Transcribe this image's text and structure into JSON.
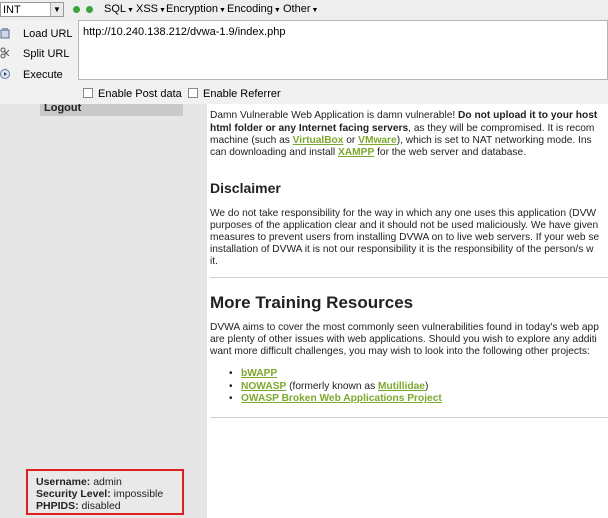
{
  "hackbar": {
    "select_value": "INT",
    "menus": [
      "SQL",
      "XSS",
      "Encryption",
      "Encoding",
      "Other"
    ],
    "load_url": "Load URL",
    "split_url": "Split URL",
    "execute": "Execute",
    "url": "http://10.240.138.212/dvwa-1.9/index.php",
    "enable_post": "Enable Post data",
    "enable_referrer": "Enable Referrer"
  },
  "sidebar": {
    "logout": "Logout"
  },
  "content": {
    "intro_l1_a": "Damn Vulnerable Web Application is damn vulnerable! ",
    "intro_l1_b": "Do not upload it to your host",
    "intro_l2_a": "html folder or any Internet facing servers",
    "intro_l2_b": ", as they will be compromised. It is recom",
    "intro_l3_a": "machine (such as ",
    "intro_l3_link1": "VirtualBox",
    "intro_l3_b": " or ",
    "intro_l3_link2": "VMware",
    "intro_l3_c": "), which is set to NAT networking mode. Ins",
    "intro_l4_a": "can downloading and install ",
    "intro_l4_link": "XAMPP",
    "intro_l4_b": " for the web server and database.",
    "disclaimer_title": "Disclaimer",
    "disc_l1": "We do not take responsibility for the way in which any one uses this application (DVW",
    "disc_l2": "purposes of the application clear and it should not be used maliciously. We have given",
    "disc_l3": "measures to prevent users from installing DVWA on to live web servers. If your web se",
    "disc_l4": "installation of DVWA it is not our responsibility it is the responsibility of the person/s w",
    "disc_l5": "it.",
    "training_title": "More Training Resources",
    "train_l1": "DVWA aims to cover the most commonly seen vulnerabilities found in today's web app",
    "train_l2": "are plenty of other issues with web applications. Should you wish to explore any additi",
    "train_l3": "want more difficult challenges, you may wish to look into the following other projects:",
    "link_bwapp": "bWAPP",
    "link_nowasp": "NOWASP",
    "nowasp_mid": " (formerly known as ",
    "link_mutillidae": "Mutillidae",
    "nowasp_end": ")",
    "link_owasp": "OWASP Broken Web Applications Project"
  },
  "userinfo": {
    "username_label": "Username:",
    "username": "admin",
    "security_label": "Security Level:",
    "security": "impossible",
    "phpids_label": "PHPIDS:",
    "phpids": "disabled"
  }
}
